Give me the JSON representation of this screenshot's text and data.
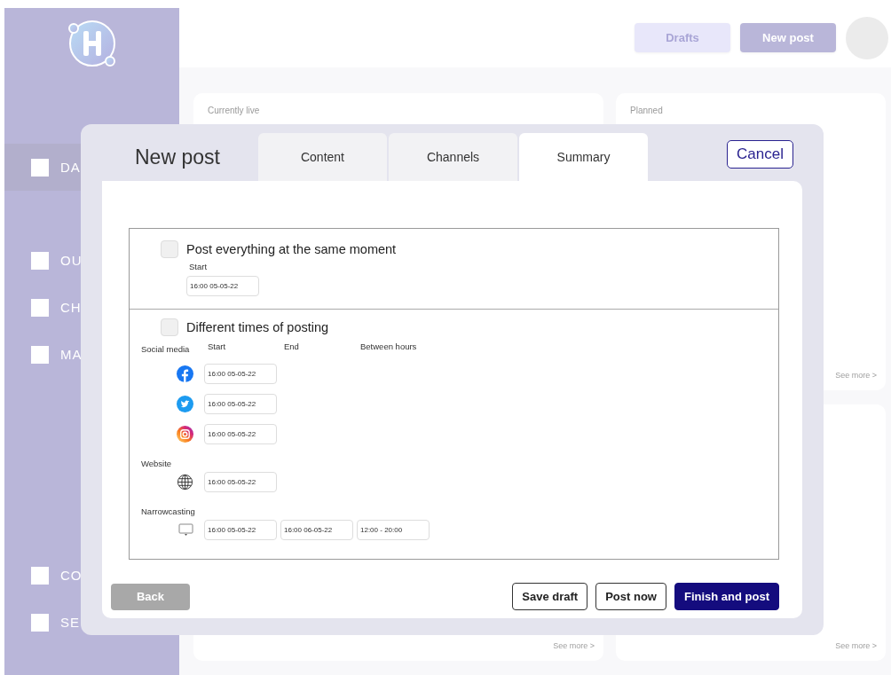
{
  "sidebar": {
    "items": [
      {
        "label": "DA",
        "selected": true
      },
      {
        "label": "OU",
        "selected": false
      },
      {
        "label": "CH",
        "selected": false
      },
      {
        "label": "MA",
        "selected": false
      },
      {
        "label": "CO",
        "selected": false
      },
      {
        "label": "SE",
        "selected": false
      }
    ]
  },
  "topbar": {
    "buttons": [
      {
        "label": "Drafts",
        "kind": "light"
      },
      {
        "label": "New post",
        "kind": "primary"
      }
    ]
  },
  "cards": [
    {
      "title": "Currently live"
    },
    {
      "title": "Planned",
      "link": "See more >"
    },
    {
      "link": "See more >"
    },
    {
      "link": "See more >"
    }
  ],
  "modal": {
    "title": "New post",
    "tabs": [
      {
        "label": "Content",
        "selected": false
      },
      {
        "label": "Channels",
        "selected": false
      },
      {
        "label": "Summary",
        "selected": true
      }
    ],
    "cancel": "Cancel",
    "sections": [
      {
        "kind": "single",
        "label": "Post everything at the same moment",
        "checked": false,
        "start_label": "Start",
        "start_value": "16:00 05-05-22"
      },
      {
        "kind": "multi",
        "label": "Different times of posting",
        "checked": false,
        "columns": [
          "Start",
          "End",
          "Between hours"
        ],
        "groups": [
          {
            "label": "Social media",
            "rows": [
              {
                "kind": "facebook",
                "values": [
                  "16:00 05-05-22"
                ]
              },
              {
                "kind": "twitter",
                "values": [
                  "16:00 05-05-22"
                ]
              },
              {
                "kind": "instagram",
                "values": [
                  "16:00 05-05-22"
                ]
              }
            ]
          },
          {
            "label": "Website",
            "rows": [
              {
                "kind": "globe",
                "values": [
                  "16:00 05-05-22"
                ]
              }
            ]
          },
          {
            "label": "Narrowcasting",
            "rows": [
              {
                "kind": "screen",
                "values": [
                  "16:00 05-05-22",
                  "16:00 06-05-22",
                  "12:00 - 20:00"
                ]
              }
            ]
          }
        ]
      }
    ],
    "footer": {
      "back": "Back",
      "actions": [
        {
          "label": "Save draft",
          "kind": "outline"
        },
        {
          "label": "Post now",
          "kind": "outline"
        },
        {
          "label": "Finish and post",
          "kind": "primary"
        }
      ]
    }
  }
}
